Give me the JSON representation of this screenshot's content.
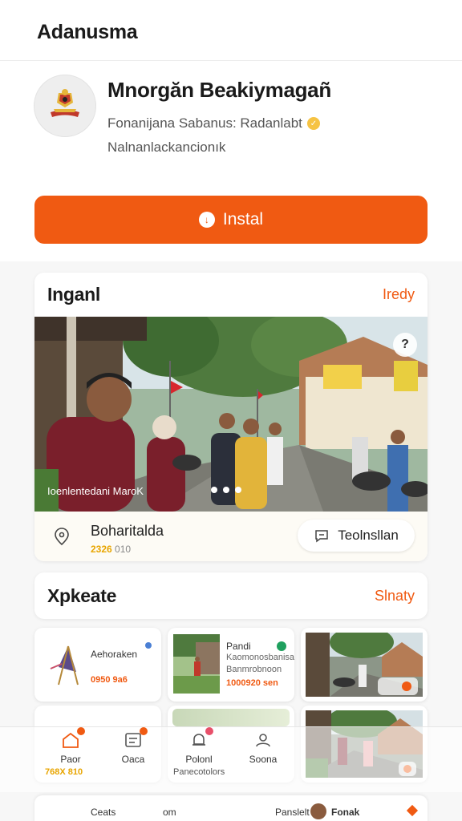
{
  "header": {
    "title": "Adanusma"
  },
  "app": {
    "name": "Mnorgăn Beakiymagañ",
    "developer": "Fonanijana Sabanus: Radanlabt",
    "category": "Nalnanlackancionık",
    "install_label": "Instal"
  },
  "gallery": {
    "title": "Inganl",
    "link": "Iredy",
    "caption": "Ioenlentedani MaroK",
    "help_label": "?",
    "location_name": "Boharitalda",
    "location_meta_highlight": "2326",
    "location_meta_rest": "010",
    "contact_label": "Teolnsllan"
  },
  "explore": {
    "title": "Xpkeate",
    "link": "Slnaty",
    "tiles": [
      {
        "name": "Aehoraken",
        "price": "0950 9a6"
      },
      {
        "name": "Pandi",
        "sub": "Kaomonosbanisakol\nBanmrobnoon",
        "price": "1000920 sen"
      }
    ]
  },
  "nav": {
    "items": [
      {
        "label": "Paor",
        "icon": "home-icon"
      },
      {
        "label": "Oaca",
        "icon": "list-icon"
      },
      {
        "label": "Polonl",
        "icon": "bell-icon"
      },
      {
        "label": "Soona",
        "icon": "profile-icon"
      }
    ],
    "sub_left": "768X 810",
    "sub_mid": "Panecotolors"
  },
  "strip": {
    "left": "Ceats",
    "mid": "om",
    "right_label": "Panslelt",
    "right_name": "Fonak"
  },
  "colors": {
    "accent": "#f05a12",
    "gold": "#e8a500"
  }
}
